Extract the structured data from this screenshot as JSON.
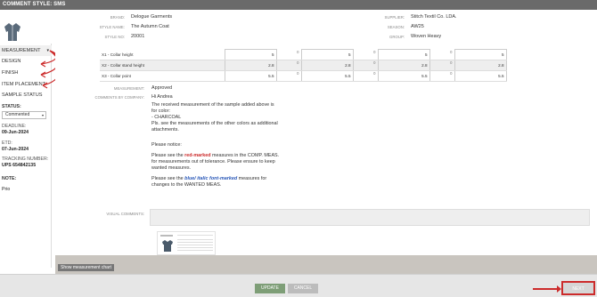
{
  "titlebar": {
    "title": "COMMENT STYLE: SMS"
  },
  "header": {
    "brand_label": "BRAND:",
    "brand": "Delogue Garments",
    "style_name_label": "STYLE NAME:",
    "style_name": "The Autumn Coat",
    "style_no_label": "STYLE NO:",
    "style_no": "20001",
    "supplier_label": "SUPPLIER:",
    "supplier": "Stitch Textil Co. LDA.",
    "season_label": "SEASON:",
    "season": "AW25",
    "group_label": "GROUP:",
    "group": "Woven Heavy"
  },
  "sidebar": {
    "items": [
      {
        "label": "MEASUREMENT"
      },
      {
        "label": "DESIGN"
      },
      {
        "label": "FINISH"
      },
      {
        "label": "ITEM PLACEMENT"
      },
      {
        "label": "SAMPLE STATUS"
      }
    ],
    "status_label": "STATUS:",
    "status_value": "Commented",
    "deadline_label": "DEADLINE:",
    "deadline": "09-Jun-2024",
    "etd_label": "ETD:",
    "etd": "07-Jun-2024",
    "tracking_label": "TRACKING NUMBER:",
    "tracking": "UPS 654842135",
    "note_label": "NOTE:",
    "note": "Prio"
  },
  "measurements": {
    "rows": [
      {
        "name": "X1 - Collar height",
        "v1": "5",
        "d1": "0",
        "v2": "5",
        "d2": "0",
        "v3": "5",
        "d3": "0",
        "v4": "5"
      },
      {
        "name": "X2 - Collar stand height",
        "v1": "2.8",
        "d1": "0",
        "v2": "2.8",
        "d2": "0",
        "v3": "2.8",
        "d3": "0",
        "v4": "2.8"
      },
      {
        "name": "X3 - Collar point",
        "v1": "5.5",
        "d1": "0",
        "v2": "5.5",
        "d2": "0",
        "v3": "5.5",
        "d3": "0",
        "v4": "5.5"
      }
    ]
  },
  "form": {
    "measurement_label": "MEASUREMENT:",
    "measurement_value": "Approved",
    "comments_label": "COMMENTS BY COMPANY:",
    "comments_greeting": "Hi Andrea",
    "comments_p1": "The received measurement of the sample added above is for color:",
    "comments_p1b": " - CHARCOAL",
    "comments_p1c": " Pls. see the measurements of the other colors as additional attachments.",
    "comments_notice": "Please notice:",
    "comments_p2_pre": "Please see the ",
    "comments_p2_em": "red-marked",
    "comments_p2_post": " measures in the COMP. MEAS. for measurements out of tolerance. Please ensure to keep wanted measures.",
    "comments_p3_pre": "Please see the ",
    "comments_p3_em": "blue/ italic font-marked",
    "comments_p3_post": " measures for changes to the WANTED MEAS.",
    "visual_label": "VISUAL COMMENTS:"
  },
  "buttons": {
    "show_chart": "Show measurement chart",
    "update": "UPDATE",
    "cancel": "CANCEL",
    "next": "NEXT"
  },
  "colors": {
    "accent_red": "#cc2b2b",
    "update_green": "#7e9e77",
    "titlebar": "#6a6a6a"
  }
}
